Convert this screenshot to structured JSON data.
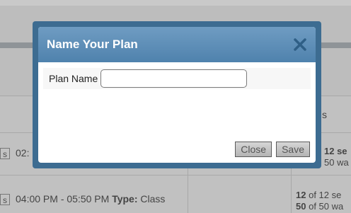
{
  "background": {
    "col_header_fragment": "s",
    "rows": [
      {
        "button_fragment": "s",
        "time_fragment": "02:",
        "seats": "12 se",
        "waitlist": "50 wa"
      },
      {
        "button_fragment": "s",
        "time": "04:00 PM - 05:50 PM",
        "type_label": "Type:",
        "type_value": "Class",
        "seats_count": "12",
        "seats_rest": "of 12 se",
        "waitlist_count": "50",
        "waitlist_rest": "of 50 wa"
      }
    ]
  },
  "dialog": {
    "title": "Name Your Plan",
    "plan_name_label": "Plan Name",
    "plan_name_value": "",
    "close_label": "Close",
    "save_label": "Save",
    "close_icon": "close-x-icon"
  },
  "colors": {
    "dialog_border": "#3d6c91",
    "titlebar_top": "#6f9cc2",
    "titlebar_bottom": "#4f82ad",
    "close_icon": "#2f5f86"
  }
}
